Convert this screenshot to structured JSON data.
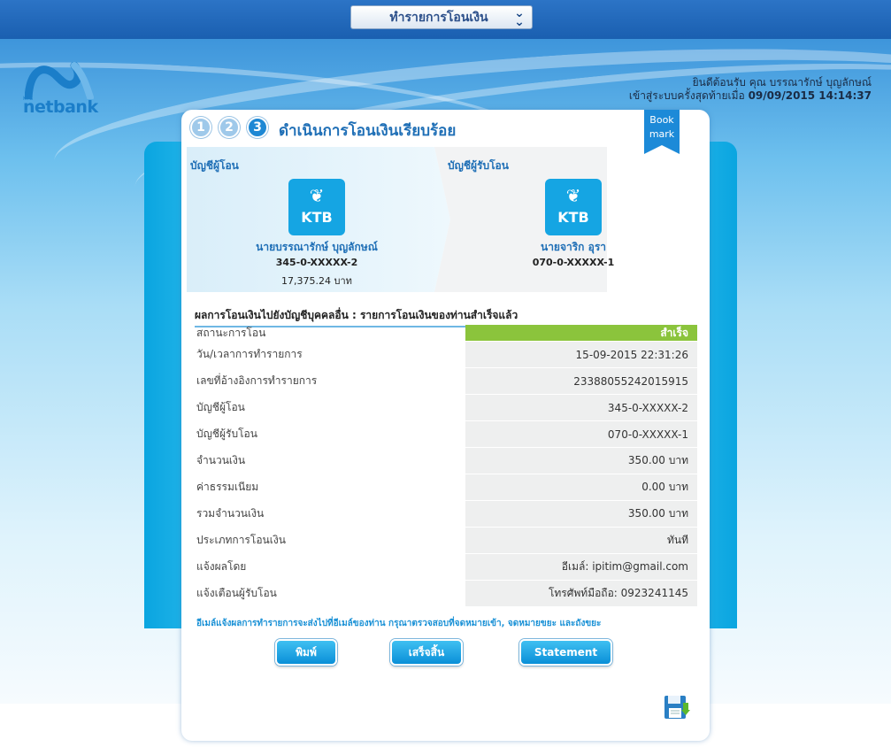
{
  "topbar": {
    "menu_label": "ทำรายการโอนเงิน",
    "menu_icon": "double-chevron-down-icon"
  },
  "logo": {
    "brand": "netbank",
    "small": "KTB"
  },
  "welcome": {
    "line1": "ยินดีต้อนรับ คุณ บรรณารักษ์ บุญลักษณ์",
    "line2_label": "เข้าสู่ระบบครั้งสุดท้ายเมื่อ",
    "line2_time": "09/09/2015 14:14:37"
  },
  "steps": [
    "1",
    "2",
    "3"
  ],
  "title": "ดำเนินการโอนเงินเรียบร้อย",
  "bookmark": {
    "line1": "Book",
    "line2": "mark"
  },
  "from_account": {
    "header": "บัญชีผู้โอน",
    "bank_logo": "KTB",
    "name": "นายบรรณารักษ์ บุญลักษณ์",
    "number": "345-0-XXXXX-2",
    "balance": "17,375.24 บาท"
  },
  "to_account": {
    "header": "บัญชีผู้รับโอน",
    "bank_logo": "KTB",
    "name": "นายจาริก อุรา",
    "number": "070-0-XXXXX-1"
  },
  "result_heading": "ผลการโอนเงินไปยังบัญชีบุคคลอื่น : รายการโอนเงินของท่านสำเร็จแล้ว",
  "rows": [
    {
      "label": "สถานะการโอน",
      "value": "สำเร็จ"
    },
    {
      "label": "วัน/เวลาการทำรายการ",
      "value": "15-09-2015 22:31:26"
    },
    {
      "label": "เลขที่อ้างอิงการทำรายการ",
      "value": "23388055242015915"
    },
    {
      "label": "บัญชีผู้โอน",
      "value": "345-0-XXXXX-2"
    },
    {
      "label": "บัญชีผู้รับโอน",
      "value": "070-0-XXXXX-1"
    },
    {
      "label": "จำนวนเงิน",
      "value": "350.00 บาท"
    },
    {
      "label": "ค่าธรรมเนียม",
      "value": "0.00 บาท"
    },
    {
      "label": "รวมจำนวนเงิน",
      "value": "350.00 บาท"
    },
    {
      "label": "ประเภทการโอนเงิน",
      "value": "ทันที"
    },
    {
      "label": "แจ้งผลโดย",
      "value": "อีเมล์: ipitim@gmail.com"
    },
    {
      "label": "แจ้งเตือนผู้รับโอน",
      "value": "โทรศัพท์มือถือ: 0923241145"
    }
  ],
  "note": "อีเมล์แจ้งผลการทำรายการจะส่งไปที่อีเมล์ของท่าน กรุณาตรวจสอบที่จดหมายเข้า, จดหมายขยะ และถังขยะ",
  "buttons": {
    "print": "พิมพ์",
    "done": "เสร็จสิ้น",
    "statement": "Statement"
  },
  "colors": {
    "primary": "#1f6fb6",
    "success": "#8bc43c",
    "button": "#0a8fd8"
  }
}
